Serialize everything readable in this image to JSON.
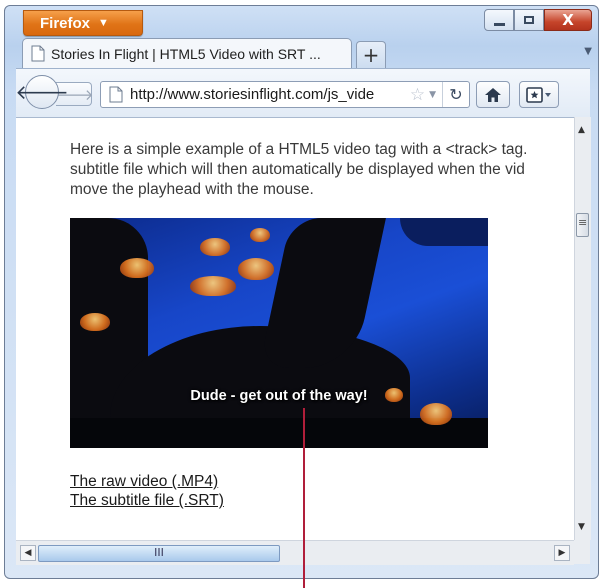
{
  "browser": {
    "menu_button_label": "Firefox",
    "window_controls": {
      "minimize": "minimize",
      "maximize": "maximize",
      "close": "X"
    }
  },
  "tab": {
    "title": "Stories In Flight | HTML5 Video with SRT ...",
    "new_tab_label": "+",
    "list_tabs_icon": "chevron-down-icon"
  },
  "navbar": {
    "url": "http://www.storiesinflight.com/js_vide",
    "back_icon": "back-arrow-icon",
    "forward_icon": "forward-arrow-icon",
    "reload_icon": "reload-icon",
    "home_icon": "home-icon",
    "bookmarks_icon": "bookmarks-icon"
  },
  "page": {
    "intro_lines": [
      "Here is a simple example of a HTML5 video tag with a <track> tag.",
      "subtitle file which will then automatically be displayed when the vid",
      "move the playhead with the mouse."
    ],
    "video_subtitle": "Dude - get out of the way!",
    "links": [
      {
        "label": "The raw video (.MP4)"
      },
      {
        "label": "The subtitle file (.SRT)"
      }
    ]
  },
  "scrollbars": {
    "horizontal_grip": "III"
  },
  "colors": {
    "firefox_orange": "#e07417",
    "close_red": "#c5442a",
    "callout_line": "#b01e3a",
    "video_blue": "#1a4fd6"
  }
}
